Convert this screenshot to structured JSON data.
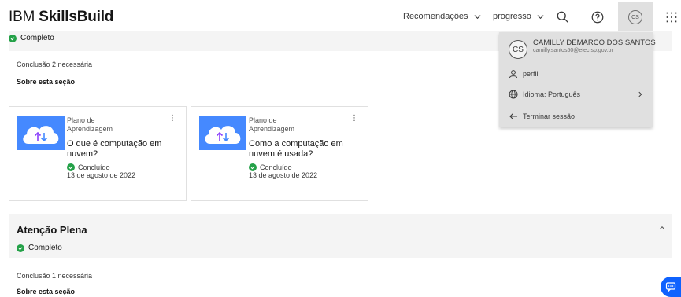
{
  "header": {
    "brand_prefix": "IBM",
    "brand_bold": "SkillsBuild",
    "nav_recommendations": "Recomendações",
    "nav_progress": "progresso",
    "avatar_initials": "CS"
  },
  "section1": {
    "status": "Completo",
    "completion_required": "Conclusão 2 necessária",
    "about": "Sobre esta seção"
  },
  "cards": [
    {
      "type_line1": "Plano de",
      "type_line2": "Aprendizagem",
      "title_line1": "O que é computação em",
      "title_line2": "nuvem?",
      "status": "Concluído",
      "date": "13 de agosto de 2022",
      "menu": "⋮"
    },
    {
      "type_line1": "Plano de",
      "type_line2": "Aprendizagem",
      "title_line1": "Como a computação em",
      "title_line2": "nuvem é usada?",
      "status": "Concluído",
      "date": "13 de agosto de 2022",
      "menu": "⋮"
    }
  ],
  "section2": {
    "title": "Atenção Plena",
    "status": "Completo",
    "completion_required": "Conclusão 1 necessária",
    "about": "Sobre esta seção"
  },
  "user_menu": {
    "initials": "CS",
    "name": "CAMILLY DEMARCO DOS SANTOS",
    "email": "camilly.santos50@etec.sp.gov.br",
    "profile": "perfil",
    "language": "Idioma: Português",
    "logout": "Terminar sessão"
  },
  "colors": {
    "accent": "#0f62fe",
    "success": "#24a148",
    "panel_gray": "#f4f4f4",
    "dropdown_gray": "#e0e0e0"
  }
}
